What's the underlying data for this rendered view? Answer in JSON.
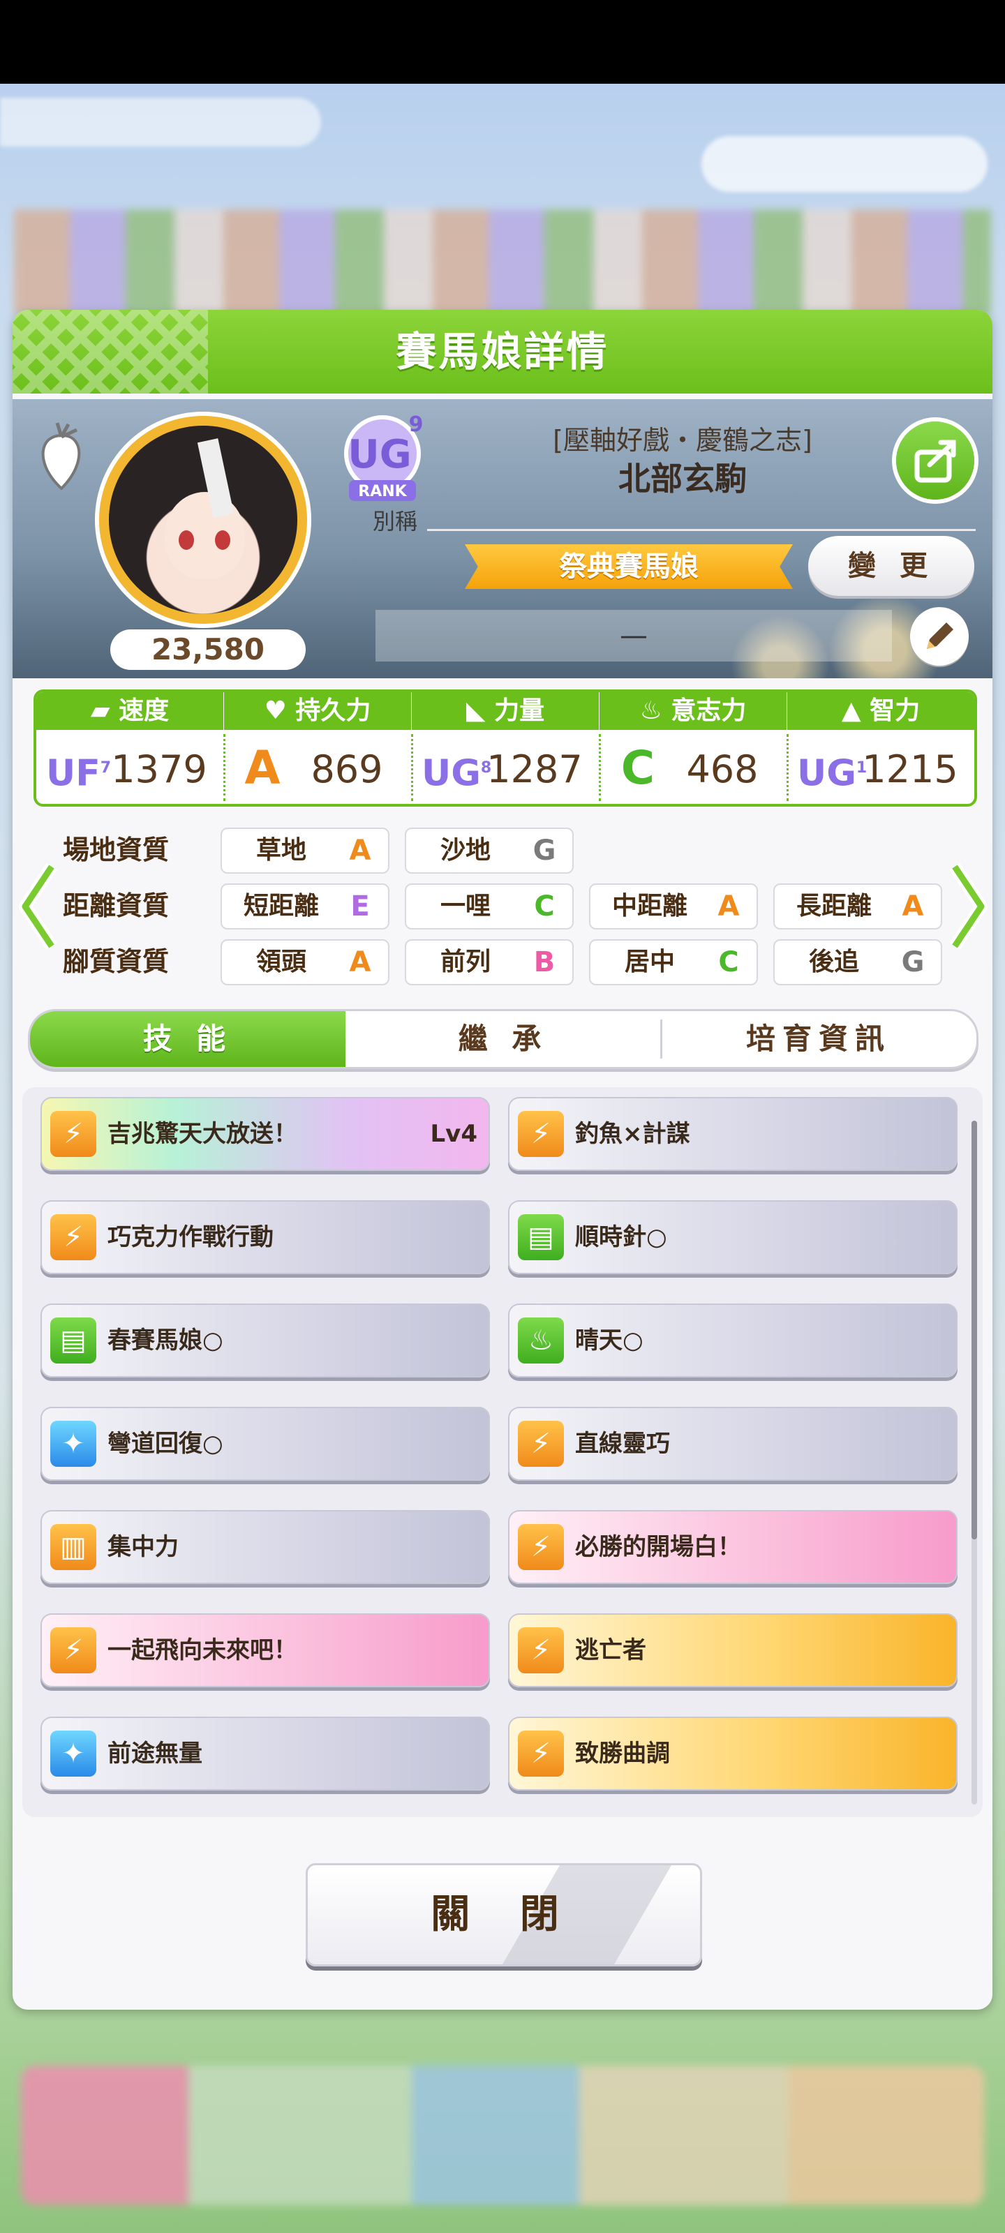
{
  "dialog": {
    "title": "賽馬娘詳情",
    "close_label": "關 閉"
  },
  "profile": {
    "fan_count": "23,580",
    "rank_badge_text": "RANK",
    "rank_badge_letters": "UG",
    "rank_badge_number": "9",
    "nickname_label": "別稱",
    "title_line1": "[壓軸好戲・慶鶴之志]",
    "title_line2": "北部玄駒",
    "title_badge": "祭典賽馬娘",
    "change_button": "變 更",
    "nickname_value": "—"
  },
  "stats": [
    {
      "label": "速度",
      "icon": "shoe-icon",
      "grade": "UF",
      "grade_num": "7",
      "value": "1379"
    },
    {
      "label": "持久力",
      "icon": "heart-icon",
      "grade": "A",
      "grade_num": "",
      "value": "869"
    },
    {
      "label": "力量",
      "icon": "muscle-icon",
      "grade": "UG",
      "grade_num": "8",
      "value": "1287"
    },
    {
      "label": "意志力",
      "icon": "flame-icon",
      "grade": "C",
      "grade_num": "",
      "value": "468"
    },
    {
      "label": "智力",
      "icon": "graduation-cap-icon",
      "grade": "UG",
      "grade_num": "1",
      "value": "1215"
    }
  ],
  "aptitude": {
    "surface": {
      "label": "場地資質",
      "items": [
        {
          "name": "草地",
          "grade": "A"
        },
        {
          "name": "沙地",
          "grade": "G"
        }
      ]
    },
    "distance": {
      "label": "距離資質",
      "items": [
        {
          "name": "短距離",
          "grade": "E"
        },
        {
          "name": "一哩",
          "grade": "C"
        },
        {
          "name": "中距離",
          "grade": "A"
        },
        {
          "name": "長距離",
          "grade": "A"
        }
      ]
    },
    "strategy": {
      "label": "腳質資質",
      "items": [
        {
          "name": "領頭",
          "grade": "A"
        },
        {
          "name": "前列",
          "grade": "B"
        },
        {
          "name": "居中",
          "grade": "C"
        },
        {
          "name": "後追",
          "grade": "G"
        }
      ]
    }
  },
  "tabs": [
    {
      "label": "技 能",
      "active": true
    },
    {
      "label": "繼 承",
      "active": false
    },
    {
      "label": "培育資訊",
      "active": false
    }
  ],
  "skills": [
    {
      "name": "吉兆驚天大放送！",
      "level": "Lv4",
      "style": "rainbow",
      "icon": "speed-up-icon"
    },
    {
      "name": "釣魚×計謀",
      "level": "",
      "style": "normal",
      "icon": "speed-up-icon"
    },
    {
      "name": "巧克力作戰行動",
      "level": "",
      "style": "normal",
      "icon": "speed-up-icon"
    },
    {
      "name": "順時針○",
      "level": "",
      "style": "normal",
      "icon": "document-icon"
    },
    {
      "name": "春賽馬娘○",
      "level": "",
      "style": "normal",
      "icon": "document-icon"
    },
    {
      "name": "晴天○",
      "level": "",
      "style": "normal",
      "icon": "flame-icon"
    },
    {
      "name": "彎道回復○",
      "level": "",
      "style": "normal",
      "icon": "sparkle-icon"
    },
    {
      "name": "直線靈巧",
      "level": "",
      "style": "normal",
      "icon": "speed-up-icon"
    },
    {
      "name": "集中力",
      "level": "",
      "style": "normal",
      "icon": "gate-icon"
    },
    {
      "name": "必勝的開場白！",
      "level": "",
      "style": "pink",
      "icon": "speed-up-icon"
    },
    {
      "name": "一起飛向未來吧！",
      "level": "",
      "style": "pink",
      "icon": "speed-up-icon"
    },
    {
      "name": "逃亡者",
      "level": "",
      "style": "gold",
      "icon": "speed-up-icon"
    },
    {
      "name": "前途無量",
      "level": "",
      "style": "normal",
      "icon": "sparkle-icon"
    },
    {
      "name": "致勝曲調",
      "level": "",
      "style": "gold",
      "icon": "speed-up-icon"
    }
  ]
}
